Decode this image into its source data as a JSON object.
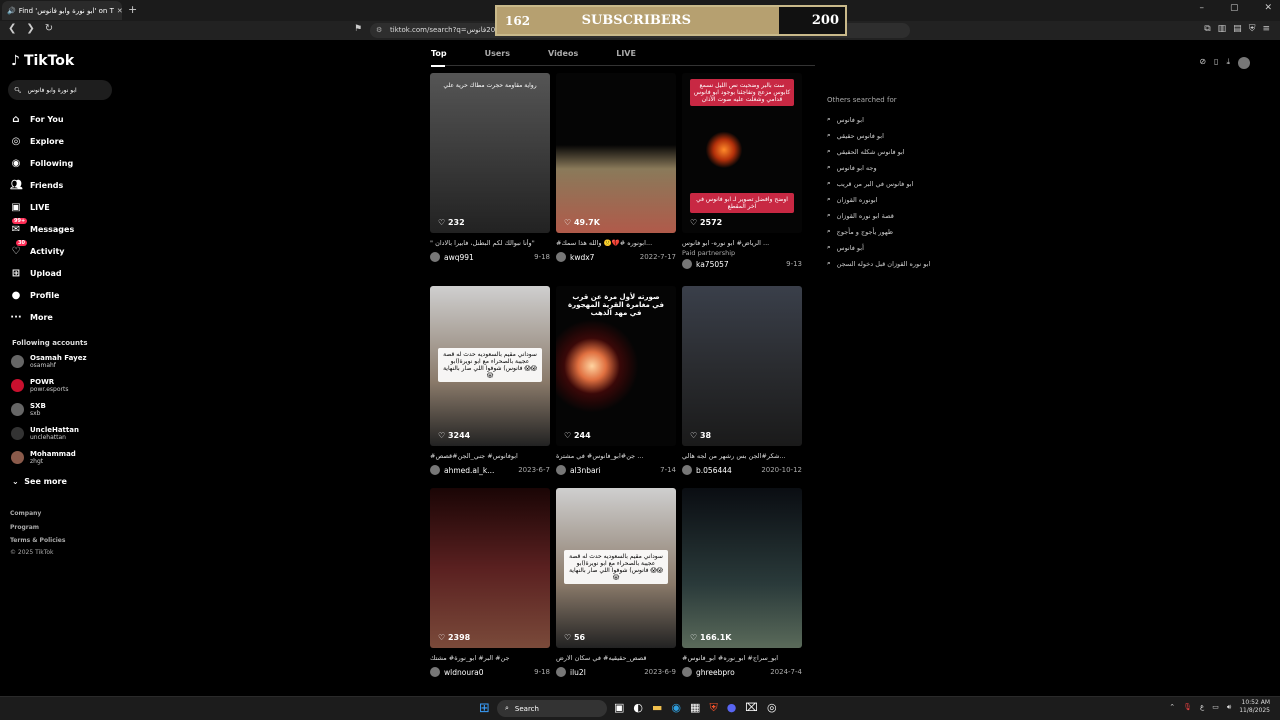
{
  "browser": {
    "tab_title": "Find 'ابو نورة وابو فانوس' on T",
    "new_tab": "+",
    "url": "tiktok.com/search?q=ابو%20فانوس",
    "window_controls": [
      "–",
      "▢",
      "✕"
    ]
  },
  "overlay": {
    "current": "162",
    "label": "SUBSCRIBERS",
    "goal": "200",
    "progress": 0.81
  },
  "sidebar": {
    "logo": "TikTok",
    "search_value": "ابو نورة وابو فانوس",
    "items": [
      {
        "label": "For You",
        "icon": "home-icon"
      },
      {
        "label": "Explore",
        "icon": "compass-icon"
      },
      {
        "label": "Following",
        "icon": "following-icon"
      },
      {
        "label": "Friends",
        "icon": "friends-icon"
      },
      {
        "label": "LIVE",
        "icon": "live-icon"
      },
      {
        "label": "Messages",
        "icon": "messages-icon",
        "badge": "99+"
      },
      {
        "label": "Activity",
        "icon": "activity-icon",
        "badge": "30"
      },
      {
        "label": "Upload",
        "icon": "upload-icon"
      },
      {
        "label": "Profile",
        "icon": "profile-icon"
      },
      {
        "label": "More",
        "icon": "more-icon"
      }
    ],
    "following_heading": "Following accounts",
    "accounts": [
      {
        "name": "Osamah Fayez",
        "handle": "osamahf"
      },
      {
        "name": "POWR",
        "handle": "powr.esports"
      },
      {
        "name": "SXB",
        "handle": "sxb"
      },
      {
        "name": "UncleHattan",
        "handle": "unclehattan"
      },
      {
        "name": "Mohammad",
        "handle": "zhgt"
      }
    ],
    "see_more": "See more",
    "footer": [
      "Company",
      "Program",
      "Terms & Policies",
      "© 2025 TikTok"
    ]
  },
  "tabs": [
    "Top",
    "Users",
    "Videos",
    "LIVE"
  ],
  "videos": [
    {
      "likes": "232",
      "desc": "\" وأنا نبوالك لكم البطنل، فابيرا بالادان\"",
      "user": "awq991",
      "date": "9-18",
      "overlay": "رواية مقاومة حجرت مطاك حرية علي"
    },
    {
      "likes": "49.7K",
      "desc": "#ابونوره #💔🙁 والله هذا سمك...",
      "user": "kwdx7",
      "date": "2022-7-17"
    },
    {
      "likes": "2572",
      "desc": "الرياض# ابو نوره- ابو فانوس ...",
      "user": "ka75057",
      "date": "9-13",
      "paid": "Paid partnership",
      "overlay": "ست بالبر وضحيت نص الليل نسمع كابوس مزعج وتفاجئنا بوجود ابو فانوس قدامي وشغلت عليه صوت الأذان",
      "overlay2": "اوضح وافضل تصوير لـ ابو فانوس في آخر المقطع"
    },
    {
      "likes": "3244",
      "desc": "#ابوفانوس# جني_الجن#قصص",
      "user": "ahmed.al_k...",
      "date": "2023-6-7",
      "overlay": "سوداني مقيم بالسعوديه حدث له قصة عجيبة بالصحراء مع ابو نويرة(ابو فانوس) شوفوا اللي صار بالنهاية 😱😱😱"
    },
    {
      "likes": "244",
      "desc": "جن#ابو_فانوس# في مشترة ...",
      "user": "al3nbari",
      "date": "7-14",
      "overlay": "صورته لأول مرة عن قرب في مغامرة القرية المهجورة في مهد الذهب"
    },
    {
      "likes": "38",
      "desc": "شكر#الجن بس رشهر من لجه هالي...",
      "user": "b.056444",
      "date": "2020-10-12"
    },
    {
      "likes": "2398",
      "desc": "جن# البر# ابو_نورة# مشتك",
      "user": "wldnoura0",
      "date": "9-18"
    },
    {
      "likes": "56",
      "desc": "قصص_حقيقيه# في سكان الارض",
      "user": "ilu2l",
      "date": "2023-6-9",
      "overlay": "سوداني مقيم بالسعوديه حدث له قصة عجيبة بالصحراء مع ابو نويرة(ابو فانوس) شوفوا اللي صار بالنهاية 😱😱😱"
    },
    {
      "likes": "166.1K",
      "desc": "#ابو_سراج# ابو_نوره# ابو_فانوس",
      "user": "ghreebpro",
      "date": "2024-7-4"
    }
  ],
  "others": {
    "heading": "Others searched for",
    "items": [
      "ابو فانوس",
      "ابو فانوس حقيقي",
      "ابو فانوس شكله الحقيقي",
      "وجه ابو فانوس",
      "ابو فانوس في البر من قريب",
      "ابونوره القوزان",
      "قصة ابو نوره القوزان",
      "ظهور يأجوج و مأجوج",
      "أبو فانوس",
      "ابو نوره القوزان قبل دخوله السجن"
    ]
  },
  "taskbar": {
    "search": "Search",
    "time": "10:52 AM",
    "date": "11/8/2025"
  }
}
